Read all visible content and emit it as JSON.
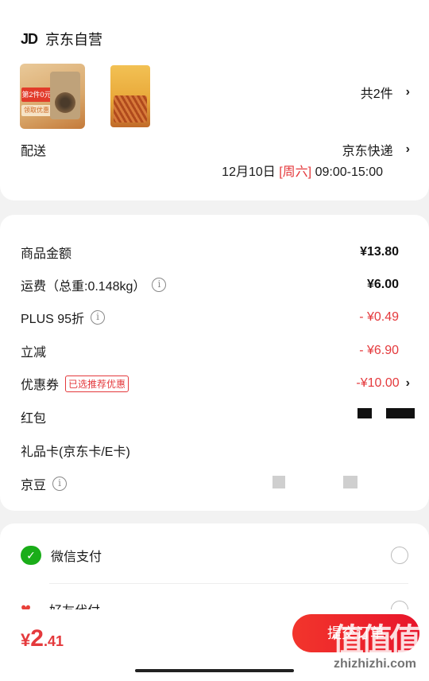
{
  "shop": {
    "logo": "JD",
    "name": "京东自营"
  },
  "items": {
    "count_text": "共2件",
    "thumb1_tag": "第2件0元",
    "thumb1_tag2": "领取优惠"
  },
  "shipping": {
    "label": "配送",
    "method": "京东快递",
    "date": "12月10日",
    "weekday": "[周六]",
    "time": "09:00-15:00"
  },
  "costs": [
    {
      "label": "商品金额",
      "value": "¥13.80"
    },
    {
      "label": "运费（总重:0.148kg）",
      "value": "¥6.00"
    },
    {
      "label": "PLUS 95折",
      "value": "- ¥0.49"
    },
    {
      "label": "立减",
      "value": "- ¥6.90"
    },
    {
      "label": "优惠券",
      "badge": "已选推荐优惠",
      "value": "-¥10.00"
    },
    {
      "label": "红包"
    },
    {
      "label": "礼品卡(京东卡/E卡)"
    },
    {
      "label": "京豆"
    }
  ],
  "payment": {
    "wechat": "微信支付",
    "friend": "好友代付"
  },
  "bottom": {
    "currency": "¥",
    "total_int": "2",
    "total_dec": ".41",
    "submit": "提交订单",
    "watermark": "值值值",
    "watermark_url": "zhizhizhi.com"
  },
  "colors": {
    "accent": "#e4393c",
    "wechat": "#1aad19"
  }
}
